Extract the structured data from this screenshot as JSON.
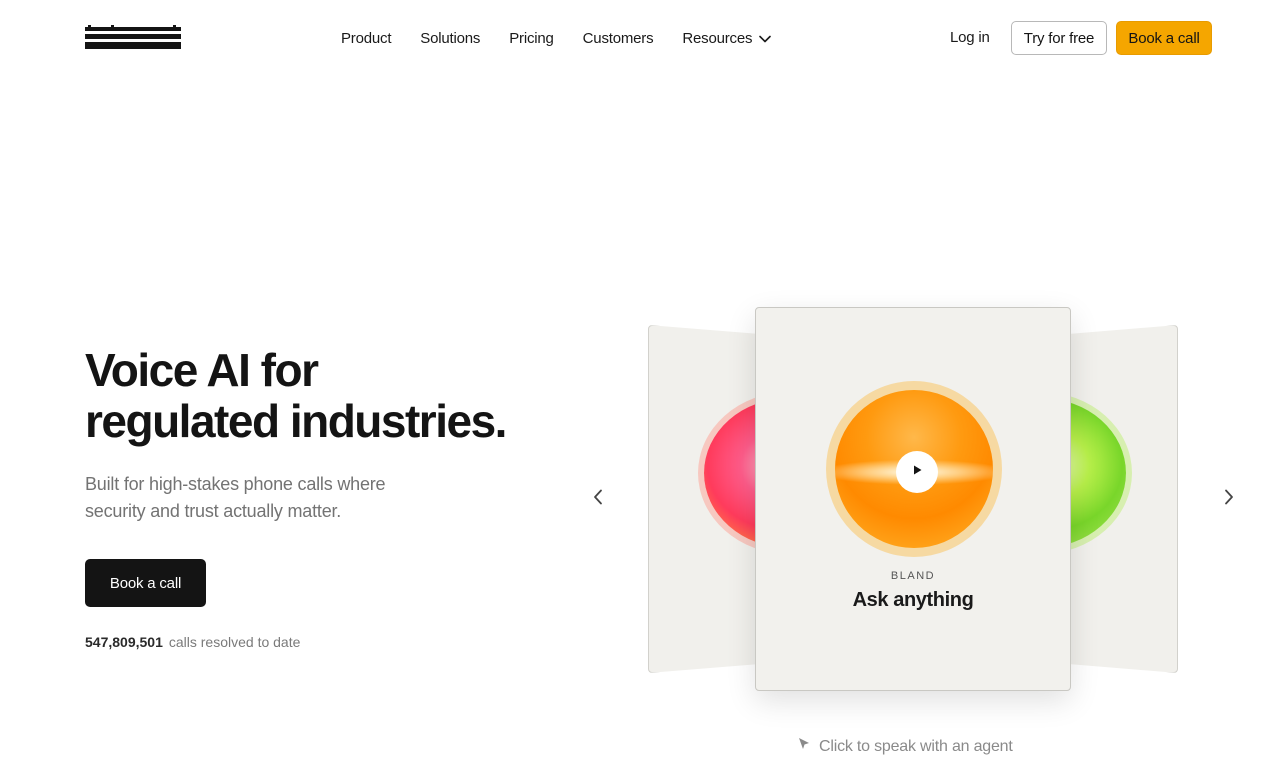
{
  "brand": {
    "logo_text": "bland"
  },
  "nav": {
    "items": [
      {
        "label": "Product"
      },
      {
        "label": "Solutions"
      },
      {
        "label": "Pricing"
      },
      {
        "label": "Customers"
      },
      {
        "label": "Resources",
        "icon": "chevron-down-icon"
      }
    ],
    "login": "Log in",
    "try_free": "Try for free",
    "book_call": "Book a call"
  },
  "hero": {
    "title_line1": "Voice AI for",
    "title_line2": "regulated industries.",
    "subtitle_line1": "Built for high-stakes phone calls where",
    "subtitle_line2": "security and trust actually matter.",
    "cta": "Book a call",
    "stat_value": "547,809,501",
    "stat_label": "calls resolved to date"
  },
  "carousel": {
    "prev_icon": "chevron-left-icon",
    "next_icon": "chevron-right-icon",
    "active_card": {
      "label": "BLAND",
      "title": "Ask anything",
      "icon": "play-icon"
    },
    "hint": "Click to speak with an agent",
    "hint_icon": "cursor-arrow-icon"
  },
  "colors": {
    "accent": "#f5a600",
    "dark": "#141414",
    "card_bg": "#f2f1ed",
    "orb_main": "#ff9a10",
    "orb_left": "#ff3b5c",
    "orb_right": "#79d62a"
  }
}
